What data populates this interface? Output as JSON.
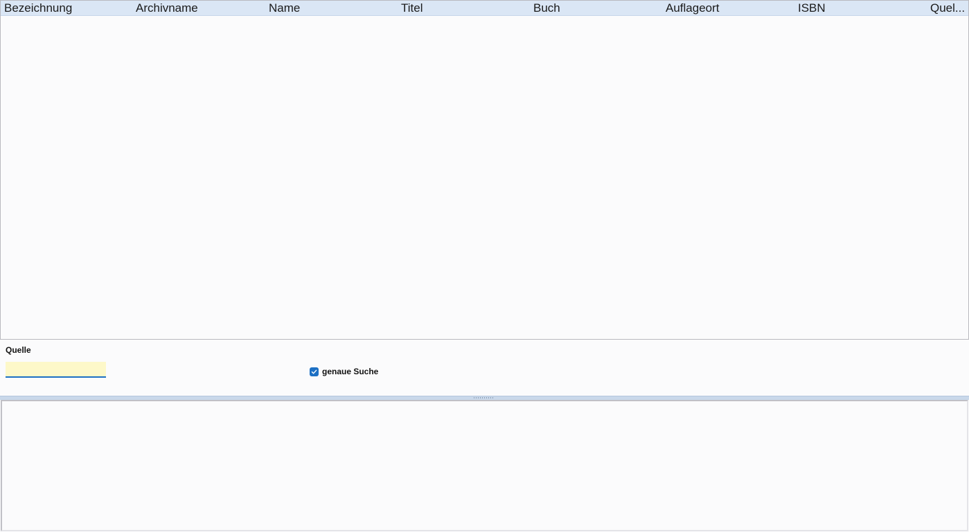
{
  "table": {
    "columns": [
      {
        "label": "Bezeichnung"
      },
      {
        "label": "Archivname"
      },
      {
        "label": "Name"
      },
      {
        "label": "Titel"
      },
      {
        "label": "Buch"
      },
      {
        "label": "Auflageort"
      },
      {
        "label": "ISBN"
      },
      {
        "label": "Quel..."
      }
    ],
    "rows": []
  },
  "filter": {
    "source_label": "Quelle",
    "source_value": "",
    "exact_search_label": "genaue Suche",
    "exact_search_checked": true
  },
  "colors": {
    "header_bg": "#dae6f5",
    "input_bg": "#fdf8c9",
    "accent": "#1d70c4"
  }
}
